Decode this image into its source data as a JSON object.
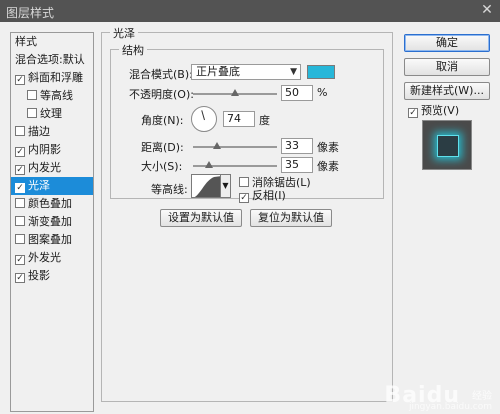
{
  "window": {
    "title": "图层样式",
    "close_icon": "close-icon"
  },
  "style_list": {
    "header": "样式",
    "blend_options": "混合选项:默认",
    "items": [
      {
        "label": "斜面和浮雕",
        "checked": true,
        "indent": false
      },
      {
        "label": "等高线",
        "checked": false,
        "indent": true
      },
      {
        "label": "纹理",
        "checked": false,
        "indent": true
      },
      {
        "label": "描边",
        "checked": false,
        "indent": false
      },
      {
        "label": "内阴影",
        "checked": true,
        "indent": false
      },
      {
        "label": "内发光",
        "checked": true,
        "indent": false
      },
      {
        "label": "光泽",
        "checked": true,
        "indent": false,
        "selected": true
      },
      {
        "label": "颜色叠加",
        "checked": false,
        "indent": false
      },
      {
        "label": "渐变叠加",
        "checked": false,
        "indent": false
      },
      {
        "label": "图案叠加",
        "checked": false,
        "indent": false
      },
      {
        "label": "外发光",
        "checked": true,
        "indent": false
      },
      {
        "label": "投影",
        "checked": true,
        "indent": false
      }
    ]
  },
  "satin": {
    "section_title": "光泽",
    "structure_title": "结构",
    "blend_mode_label": "混合模式(B):",
    "blend_mode_value": "正片叠底",
    "color": "#27b7d9",
    "opacity_label": "不透明度(O):",
    "opacity_value": "50",
    "opacity_unit": "%",
    "angle_label": "角度(N):",
    "angle_value": "74",
    "angle_unit": "度",
    "distance_label": "距离(D):",
    "distance_value": "33",
    "distance_unit": "像素",
    "size_label": "大小(S):",
    "size_value": "35",
    "size_unit": "像素",
    "contour_label": "等高线:",
    "anti_alias_label": "消除锯齿(L)",
    "anti_alias_checked": false,
    "invert_label": "反相(I)",
    "invert_checked": true,
    "set_default_button": "设置为默认值",
    "reset_default_button": "复位为默认值"
  },
  "right_buttons": {
    "ok": "确定",
    "cancel": "取消",
    "new_style": "新建样式(W)...",
    "preview_label": "预览(V)",
    "preview_checked": true
  },
  "watermark": {
    "text": "Baidu",
    "sub": "经验",
    "small": "jingyan.baidu.com"
  },
  "check_mark": "☑"
}
